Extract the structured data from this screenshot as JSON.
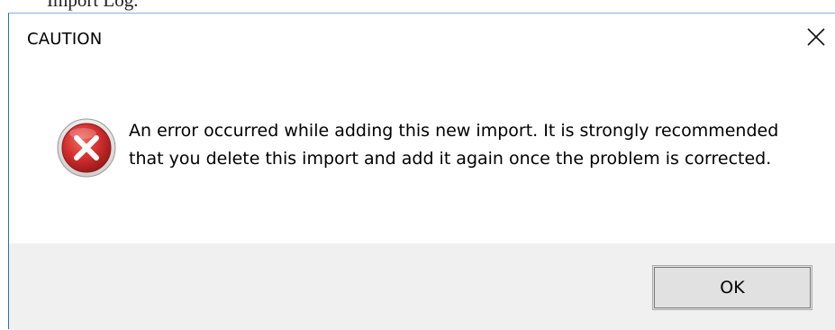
{
  "background": {
    "partial_text": "Import Log."
  },
  "dialog": {
    "title": "CAUTION",
    "close_icon": "close-icon",
    "error_icon": "error-icon",
    "message": "An error occurred while adding this new import. It is strongly recommended that you delete this import and add it again once the problem is corrected.",
    "ok_label": "OK"
  },
  "colors": {
    "dialog_border": "#1a73c8",
    "footer_bg": "#f0f0f0",
    "button_bg": "#e1e1e1",
    "error_red": "#c62828"
  }
}
